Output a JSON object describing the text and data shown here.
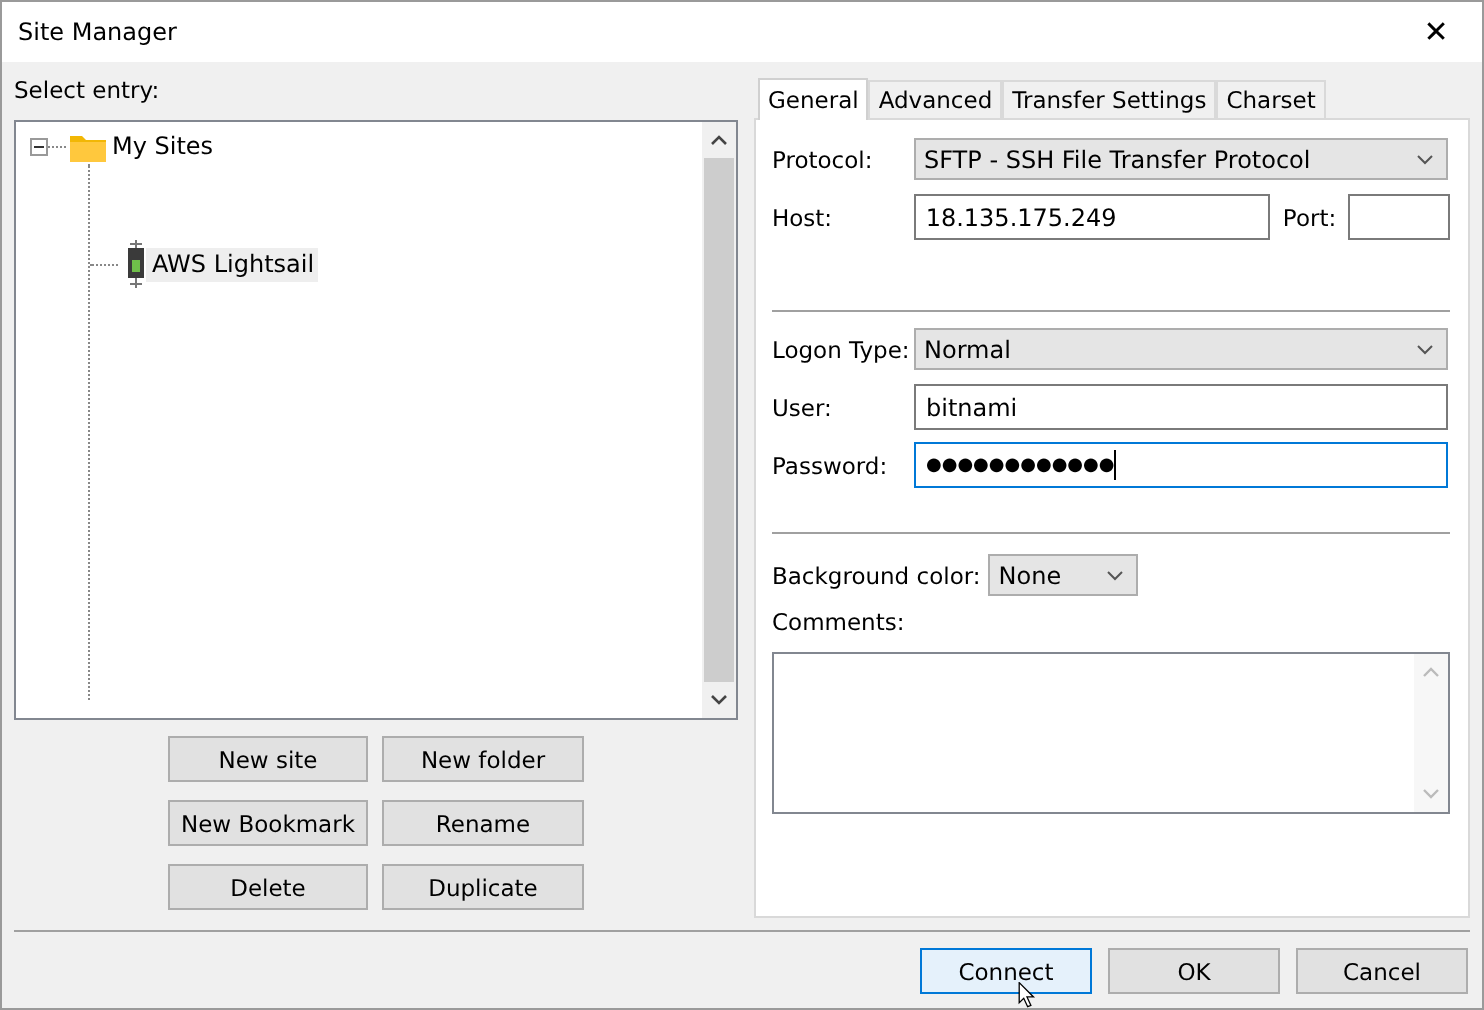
{
  "window": {
    "title": "Site Manager",
    "close": "✕"
  },
  "tree": {
    "label": "Select entry:",
    "items": [
      {
        "label": "My Sites",
        "kind": "folder",
        "expanded": true,
        "selected": false,
        "children": [
          {
            "label": "AWS Lightsail",
            "kind": "site",
            "selected": true
          }
        ]
      }
    ]
  },
  "tree_buttons": [
    {
      "label": "New site"
    },
    {
      "label": "New folder"
    },
    {
      "label": "New Bookmark"
    },
    {
      "label": "Rename"
    },
    {
      "label": "Delete"
    },
    {
      "label": "Duplicate"
    }
  ],
  "tabs": [
    {
      "label": "General",
      "selected": true
    },
    {
      "label": "Advanced",
      "selected": false
    },
    {
      "label": "Transfer Settings",
      "selected": false
    },
    {
      "label": "Charset",
      "selected": false
    }
  ],
  "general": {
    "protocol": {
      "label": "Protocol:",
      "value": "SFTP - SSH File Transfer Protocol"
    },
    "host": {
      "label": "Host:",
      "value": "18.135.175.249",
      "focused": false
    },
    "port": {
      "label": "Port:",
      "focused": false
    },
    "logon_type": {
      "label": "Logon Type:",
      "value": "Normal"
    },
    "user": {
      "label": "User:",
      "value": "bitnami",
      "focused": false
    },
    "password": {
      "label": "Password:",
      "value": "●●●●●●●●●●●●",
      "focused": true
    },
    "background_color": {
      "label": "Background color:",
      "value": "None"
    },
    "comments": {
      "label": "Comments:"
    }
  },
  "buttons": [
    {
      "label": "Connect",
      "default": true
    },
    {
      "label": "OK",
      "default": false
    },
    {
      "label": "Cancel",
      "default": false
    }
  ]
}
